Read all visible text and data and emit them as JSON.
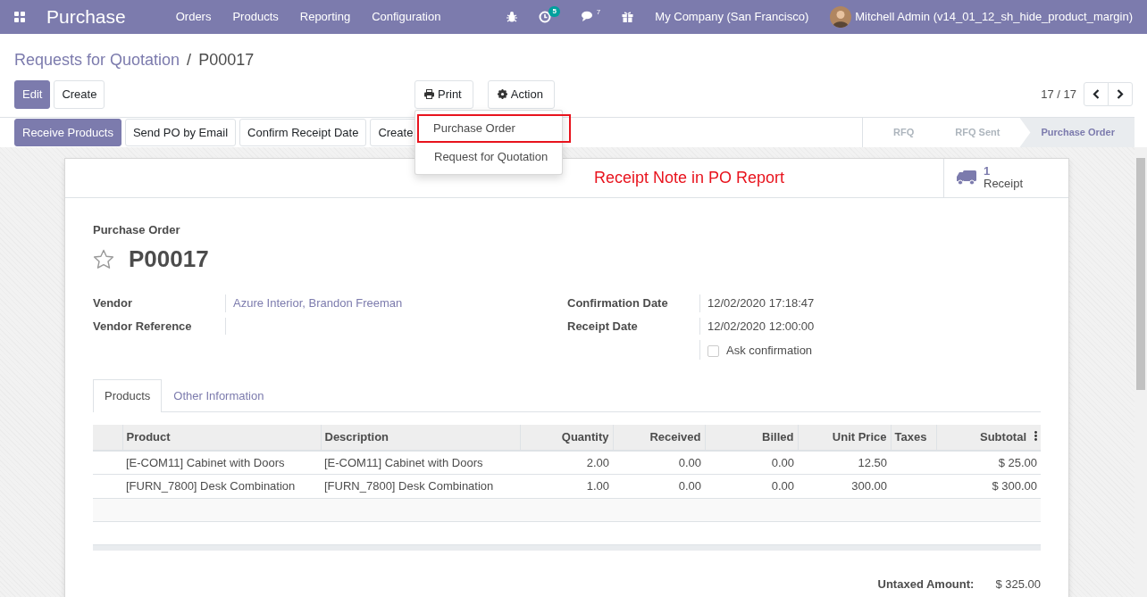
{
  "navbar": {
    "app": "Purchase",
    "menus": [
      "Orders",
      "Products",
      "Reporting",
      "Configuration"
    ],
    "activity_count": "5",
    "message_count": "7",
    "company": "My Company (San Francisco)",
    "user": "Mitchell Admin (v14_01_12_sh_hide_product_margin)"
  },
  "breadcrumb": [
    "Requests for Quotation",
    "P00017"
  ],
  "breadcrumb_separator": "/",
  "buttons": {
    "edit": "Edit",
    "create": "Create",
    "print": "Print",
    "action": "Action"
  },
  "pager": "17 / 17",
  "print_menu": [
    {
      "label": "Purchase Order",
      "highlighted": true
    },
    {
      "label": "Request for Quotation",
      "highlighted": false
    }
  ],
  "status_buttons": [
    {
      "label": "Receive Products",
      "primary": true
    },
    {
      "label": "Send PO by Email",
      "primary": false
    },
    {
      "label": "Confirm Receipt Date",
      "primary": false
    },
    {
      "label": "Create",
      "primary": false
    }
  ],
  "stages": [
    {
      "label": "RFQ",
      "selected": false
    },
    {
      "label": "RFQ Sent",
      "selected": false
    },
    {
      "label": "Purchase Order",
      "selected": true
    }
  ],
  "annotation": "Receipt Note in PO Report",
  "smart_button": {
    "count": "1",
    "label": "Receipt"
  },
  "form": {
    "kind_label": "Purchase Order",
    "name": "P00017",
    "starred": false,
    "left_fields": [
      {
        "label": "Vendor",
        "value": "Azure Interior, Brandon Freeman",
        "link": true
      },
      {
        "label": "Vendor Reference"
      }
    ],
    "right_fields": [
      {
        "label": "Confirmation Date",
        "value": "12/02/2020 17:18:47"
      },
      {
        "label": "Receipt Date",
        "value": "12/02/2020 12:00:00"
      }
    ],
    "ask_confirmation": {
      "label": "Ask confirmation",
      "checked": false
    }
  },
  "tabs": [
    {
      "label": "Products",
      "selected": true
    },
    {
      "label": "Other Information",
      "selected": false
    }
  ],
  "table": {
    "columns": [
      {
        "label": "Product",
        "numeric": false
      },
      {
        "label": "Description",
        "numeric": false
      },
      {
        "label": "Quantity",
        "numeric": true
      },
      {
        "label": "Received",
        "numeric": true
      },
      {
        "label": "Billed",
        "numeric": true
      },
      {
        "label": "Unit Price",
        "numeric": true
      },
      {
        "label": "Taxes",
        "numeric": false
      },
      {
        "label": "Subtotal",
        "numeric": true
      }
    ],
    "rows": [
      [
        "[E-COM11] Cabinet with Doors",
        "[E-COM11] Cabinet with Doors",
        "2.00",
        "0.00",
        "0.00",
        "12.50",
        "",
        "$ 25.00"
      ],
      [
        "[FURN_7800] Desk Combination",
        "[FURN_7800] Desk Combination",
        "1.00",
        "0.00",
        "0.00",
        "300.00",
        "",
        "$ 300.00"
      ]
    ]
  },
  "totals": [
    {
      "label": "Untaxed Amount:",
      "value": "$ 325.00"
    }
  ]
}
